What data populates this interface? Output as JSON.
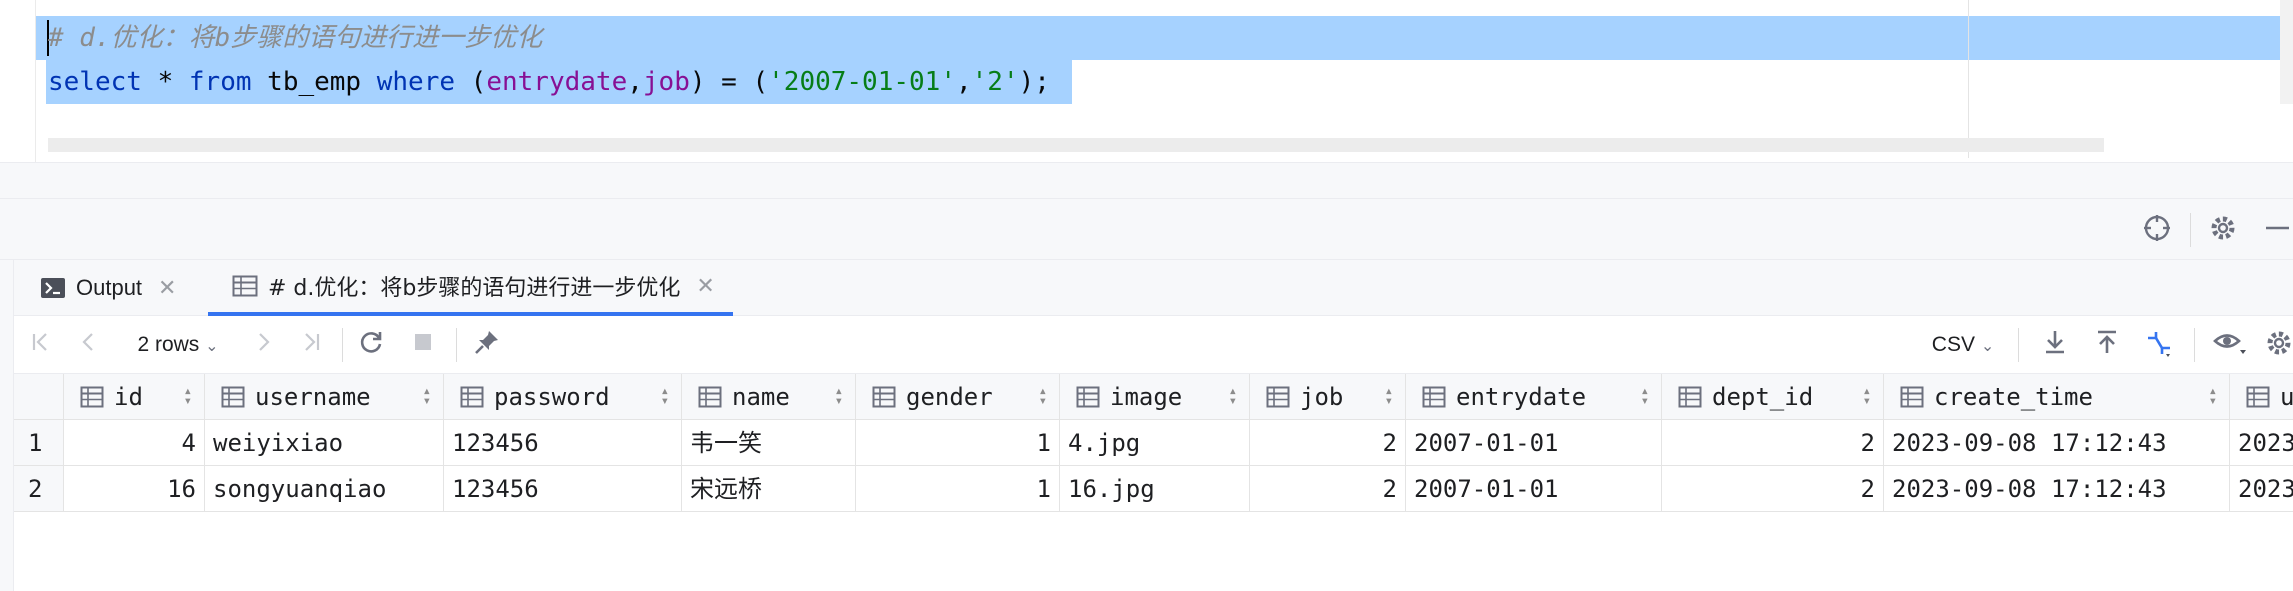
{
  "editor": {
    "comment_line": "# d.优化：将b步骤的语句进行进一步优化",
    "sql": {
      "kw_select": "select",
      "star": " * ",
      "kw_from": "from",
      "table": " tb_emp ",
      "kw_where": "where",
      "open": " (",
      "field1": "entrydate",
      "comma1": ",",
      "field2": "job",
      "mid": ") = (",
      "val1": "'2007-01-01'",
      "comma2": ",",
      "val2": "'2'",
      "end": ");"
    }
  },
  "tabs": [
    {
      "label": "Output",
      "icon": "console-output-icon"
    },
    {
      "label": "# d.优化：将b步骤的语句进行进一步优化",
      "icon": "table-grid-icon",
      "active": true
    }
  ],
  "toolbar": {
    "rows_label": "2 rows",
    "format_label": "CSV"
  },
  "grid": {
    "columns": [
      "id",
      "username",
      "password",
      "name",
      "gender",
      "image",
      "job",
      "entrydate",
      "dept_id",
      "create_time",
      "u"
    ],
    "rows": [
      {
        "num": "1",
        "cells": [
          "4",
          "weiyixiao",
          "123456",
          "韦一笑",
          "1",
          "4.jpg",
          "2",
          "2007-01-01",
          "2",
          "2023-09-08 17:12:43",
          "2023"
        ]
      },
      {
        "num": "2",
        "cells": [
          "16",
          "songyuanqiao",
          "123456",
          "宋远桥",
          "1",
          "16.jpg",
          "2",
          "2007-01-01",
          "2",
          "2023-09-08 17:12:43",
          "2023"
        ]
      }
    ]
  },
  "colors": {
    "selection": "#a6d2ff",
    "keyword": "#0033b3",
    "field": "#871094",
    "string": "#067d17",
    "active_tab_underline": "#3574f0"
  }
}
